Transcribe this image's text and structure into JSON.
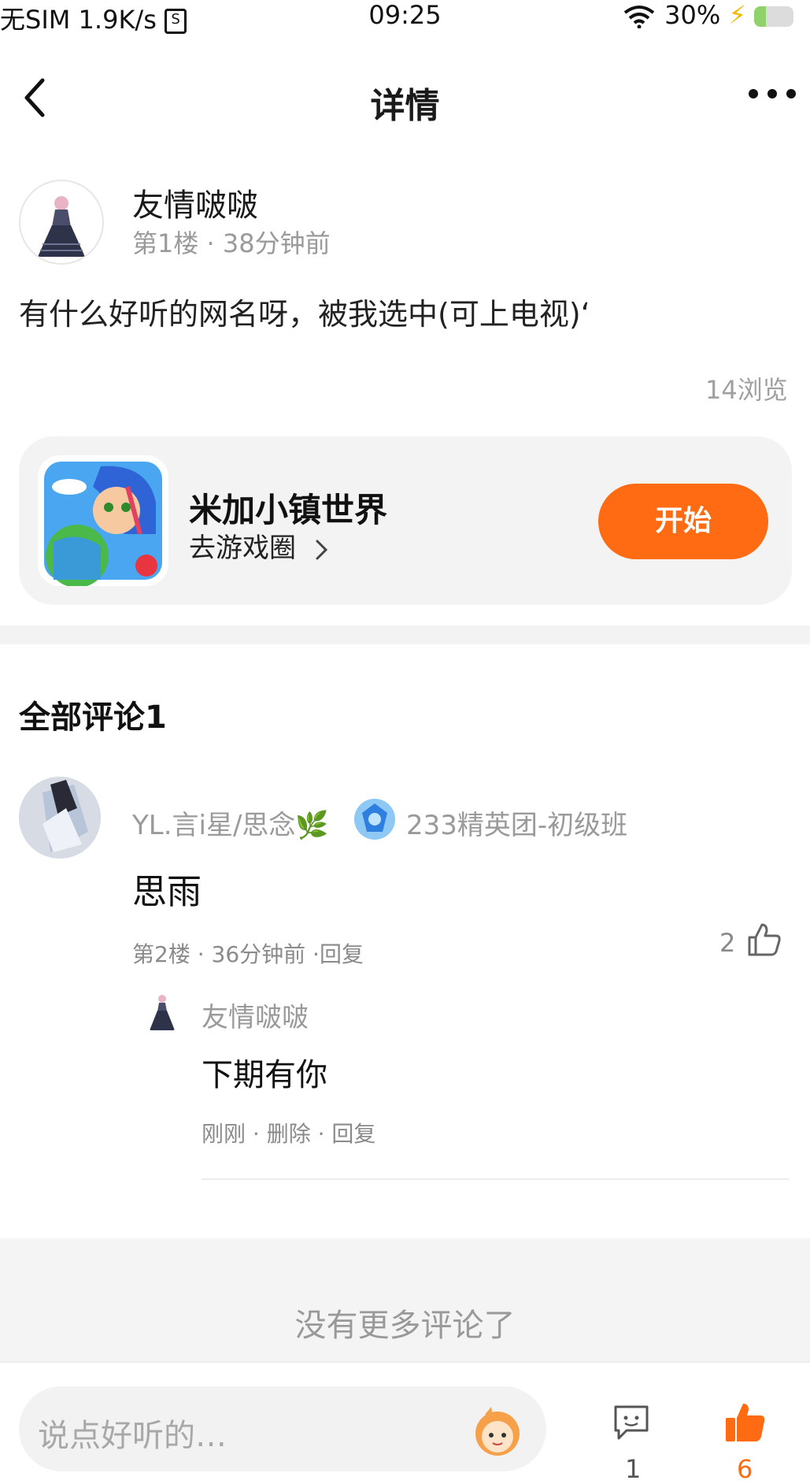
{
  "status_bar": {
    "carrier": "无SIM",
    "speed": "1.9K/s",
    "time": "09:25",
    "battery": "30%"
  },
  "nav": {
    "back_icon": "chevron-left-icon",
    "title": "详情",
    "more_icon": "more-dots-icon"
  },
  "post": {
    "author": "友情啵啵",
    "floor_time": "第1楼 · 38分钟前",
    "text": "有什么好听的网名呀，被我选中(可上电视)‘",
    "views": "14浏览"
  },
  "game_card": {
    "name": "米加小镇世界",
    "link": "去游戏圈",
    "start_label": "开始",
    "accent": "#ff6b12"
  },
  "comments_header": "全部评论1",
  "comment": {
    "user": "YL.言i星/思念",
    "badge": "233精英团-初级班",
    "text": "思雨",
    "meta": "第2楼 · 36分钟前 ·回复",
    "likes": "2"
  },
  "reply": {
    "user": "友情啵啵",
    "text": "下期有你",
    "meta": "刚刚 · 删除 · 回复"
  },
  "no_more": "没有更多评论了",
  "bottom_bar": {
    "placeholder": "说点好听的…",
    "comment_count": "1",
    "like_count": "6"
  }
}
